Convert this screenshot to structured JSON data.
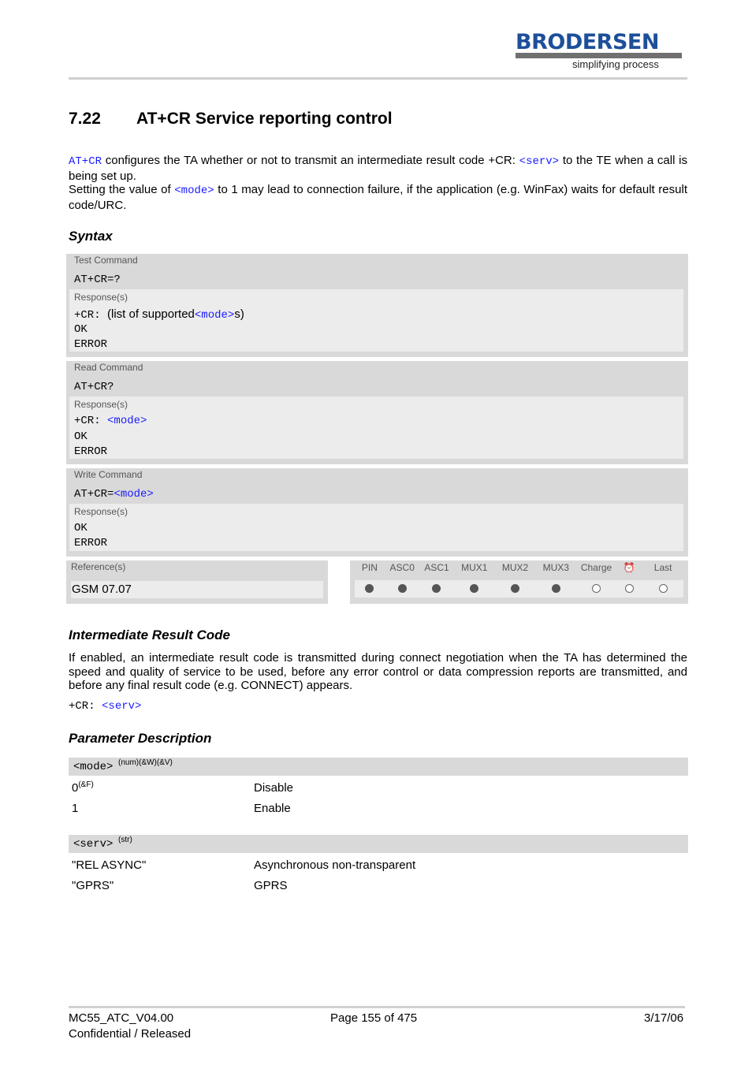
{
  "logo": {
    "name": "BRODERSEN",
    "tagline": "simplifying process"
  },
  "section": {
    "number": "7.22",
    "title": "AT+CR   Service reporting control"
  },
  "intro": {
    "p1_link": "AT+CR",
    "p1_text": " configures the TA whether or not to transmit an intermediate result code +CR: ",
    "p1_param": "<serv>",
    "p1_end": " to the TE when a call is being set up.",
    "p2_text": "Setting the value of ",
    "p2_param": "<mode>",
    "p2_end": " to 1 may lead to connection failure, if the application (e.g. WinFax) waits for default result code/URC."
  },
  "syntax": {
    "heading": "Syntax",
    "test": {
      "label": "Test Command",
      "cmd": "AT+CR=?",
      "resp_label": "Response(s)",
      "resp1_prefix": "+CR: ",
      "resp1_text": "(list of supported",
      "resp1_param": "<mode>",
      "resp1_end": "s)",
      "ok": "OK",
      "error": "ERROR"
    },
    "read": {
      "label": "Read Command",
      "cmd": "AT+CR?",
      "resp_label": "Response(s)",
      "resp1_prefix": "+CR: ",
      "resp1_param": "<mode>",
      "ok": "OK",
      "error": "ERROR"
    },
    "write": {
      "label": "Write Command",
      "cmd": "AT+CR=",
      "cmd_param": "<mode>",
      "resp_label": "Response(s)",
      "ok": "OK",
      "error": "ERROR"
    },
    "reference": {
      "label": "Reference(s)",
      "value": "GSM 07.07"
    },
    "status": {
      "columns": [
        "PIN",
        "ASC0",
        "ASC1",
        "MUX1",
        "MUX2",
        "MUX3",
        "Charge",
        "alarm-clock-icon",
        "Last"
      ],
      "values": [
        true,
        true,
        true,
        true,
        true,
        true,
        false,
        false,
        false
      ]
    }
  },
  "irc": {
    "heading": "Intermediate Result Code",
    "text": "If enabled, an intermediate result code is transmitted during connect negotiation when the TA has determined the speed and quality of service to be used, before any error control or data compression reports are transmitted, and before any final result code (e.g. CONNECT) appears.",
    "code_prefix": "+CR: ",
    "code_param": "<serv>"
  },
  "params": {
    "heading": "Parameter Description",
    "mode": {
      "name": "<mode>",
      "sup": "(num)(&W)(&V)",
      "rows": [
        {
          "value": "0",
          "sup": "(&F)",
          "desc": "Disable"
        },
        {
          "value": "1",
          "sup": "",
          "desc": "Enable"
        }
      ]
    },
    "serv": {
      "name": "<serv>",
      "sup": "(str)",
      "rows": [
        {
          "value": "\"REL ASYNC\"",
          "desc": "Asynchronous non-transparent"
        },
        {
          "value": "\"GPRS\"",
          "desc": "GPRS"
        }
      ]
    }
  },
  "footer": {
    "doc": "MC55_ATC_V04.00",
    "status": "Confidential / Released",
    "page": "Page 155 of 475",
    "date": "3/17/06"
  }
}
